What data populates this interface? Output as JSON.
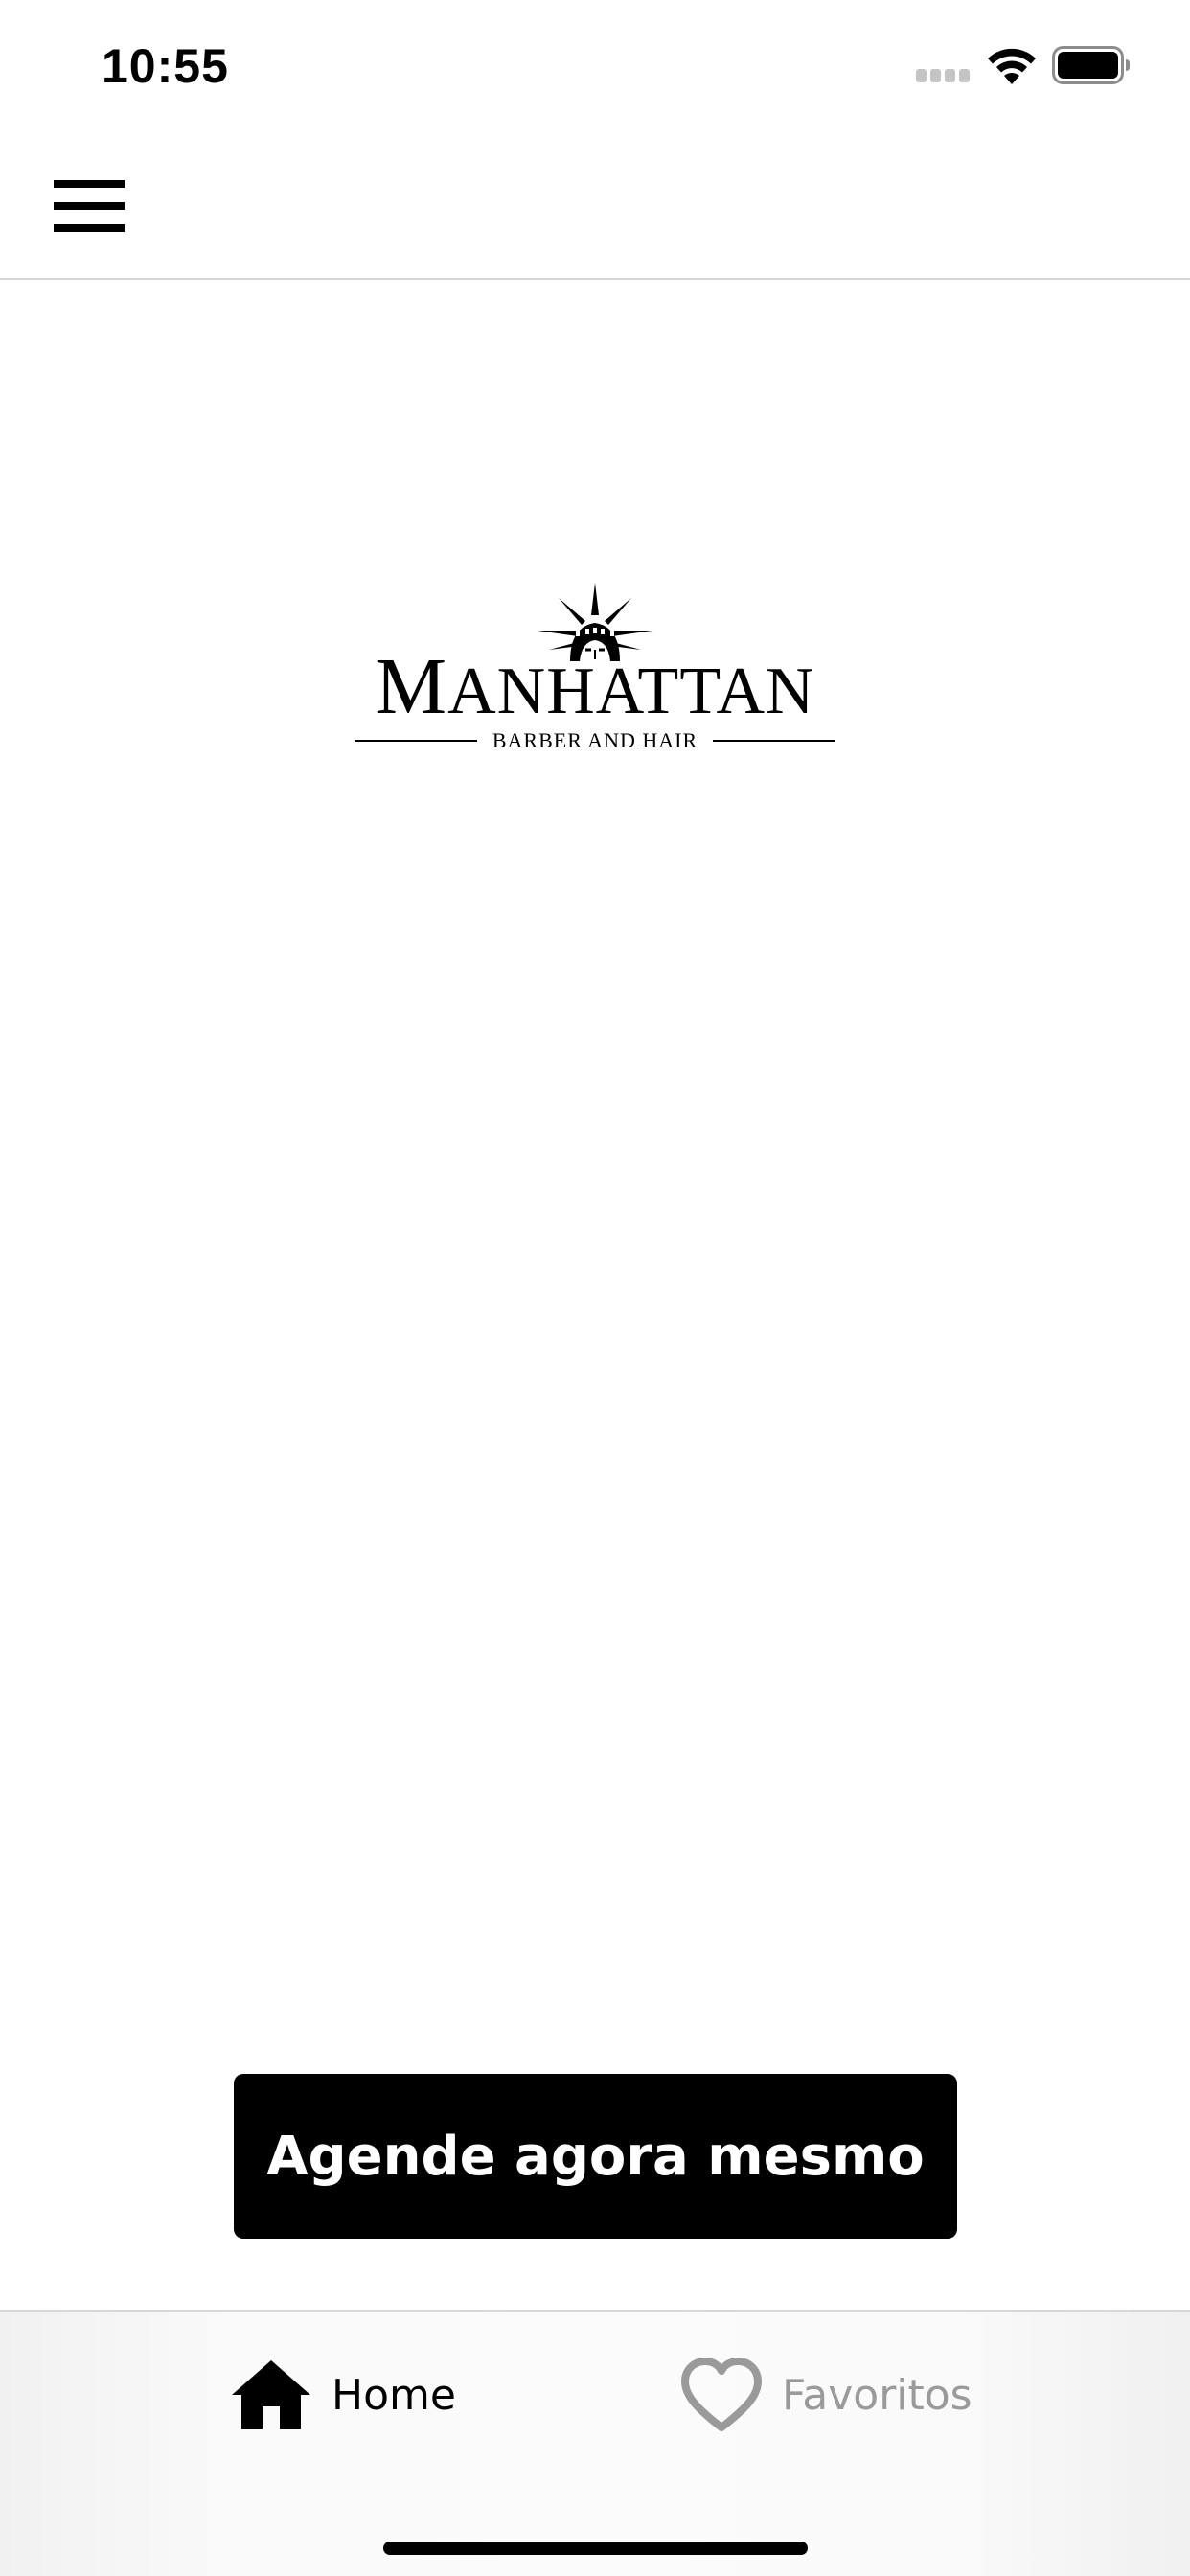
{
  "status_bar": {
    "time": "10:55"
  },
  "top_nav": {
    "menu_icon": "hamburger-menu-icon"
  },
  "logo": {
    "title_first": "M",
    "title_rest": "ANHATTAN",
    "subtitle": "BARBER AND HAIR"
  },
  "cta": {
    "label": "Agende agora mesmo"
  },
  "tab_bar": {
    "tabs": [
      {
        "label": "Home",
        "icon": "home-icon",
        "active": true
      },
      {
        "label": "Favoritos",
        "icon": "heart-icon",
        "active": false
      }
    ]
  },
  "colors": {
    "primary": "#000000",
    "background": "#ffffff",
    "inactive_tab": "#9a9a9a",
    "divider": "#d6d6d6"
  }
}
